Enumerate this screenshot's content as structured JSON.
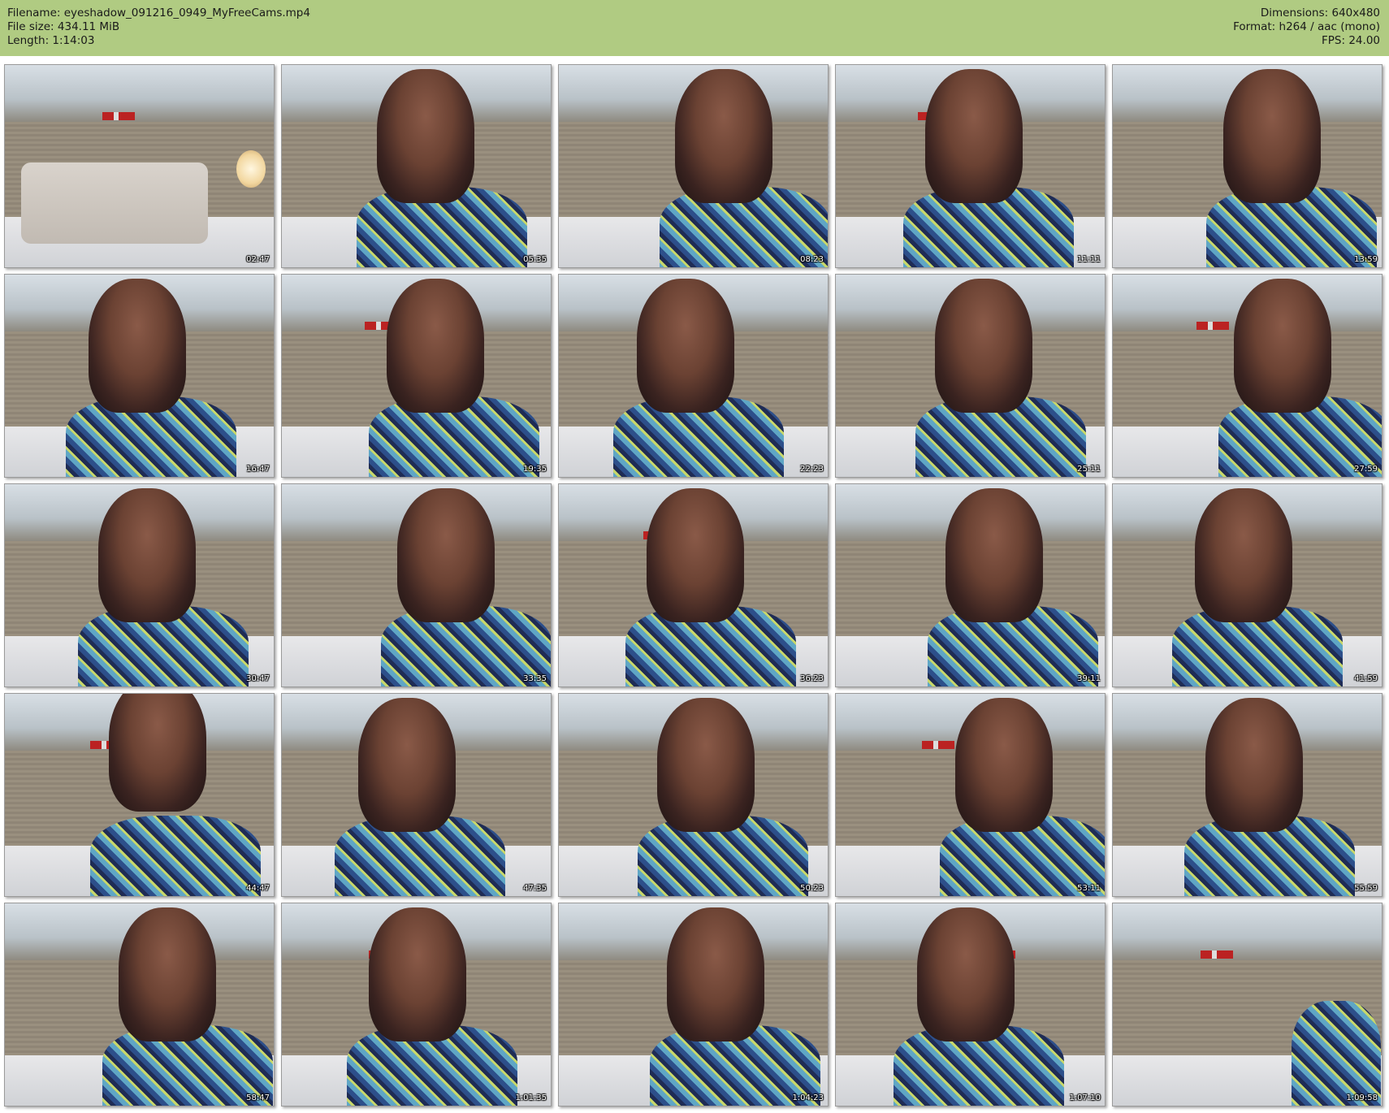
{
  "header": {
    "filename": "Filename: eyeshadow_091216_0949_MyFreeCams.mp4",
    "filesize": "File size: 434.11 MiB",
    "length": "Length: 1:14:03",
    "dimensions": "Dimensions: 640x480",
    "format": "Format: h264 / aac (mono)",
    "fps": "FPS: 24.00"
  },
  "colors": {
    "header_bg": "#b0cb82",
    "wall": "#b9c2c8",
    "headboard": "#8f8576",
    "bed": "#e8e8ea",
    "dress": "#2d4f8a"
  },
  "thumbnails": [
    {
      "timestamp": "02:47"
    },
    {
      "timestamp": "05:35"
    },
    {
      "timestamp": "08:23"
    },
    {
      "timestamp": "11:11"
    },
    {
      "timestamp": "13:59"
    },
    {
      "timestamp": "16:47"
    },
    {
      "timestamp": "19:35"
    },
    {
      "timestamp": "22:23"
    },
    {
      "timestamp": "25:11"
    },
    {
      "timestamp": "27:59"
    },
    {
      "timestamp": "30:47"
    },
    {
      "timestamp": "33:35"
    },
    {
      "timestamp": "36:23"
    },
    {
      "timestamp": "39:11"
    },
    {
      "timestamp": "41:59"
    },
    {
      "timestamp": "44:47"
    },
    {
      "timestamp": "47:35"
    },
    {
      "timestamp": "50:23"
    },
    {
      "timestamp": "53:11"
    },
    {
      "timestamp": "55:59"
    },
    {
      "timestamp": "58:47"
    },
    {
      "timestamp": "1:01:35"
    },
    {
      "timestamp": "1:04:23"
    },
    {
      "timestamp": "1:07:10"
    },
    {
      "timestamp": "1:09:58"
    }
  ]
}
